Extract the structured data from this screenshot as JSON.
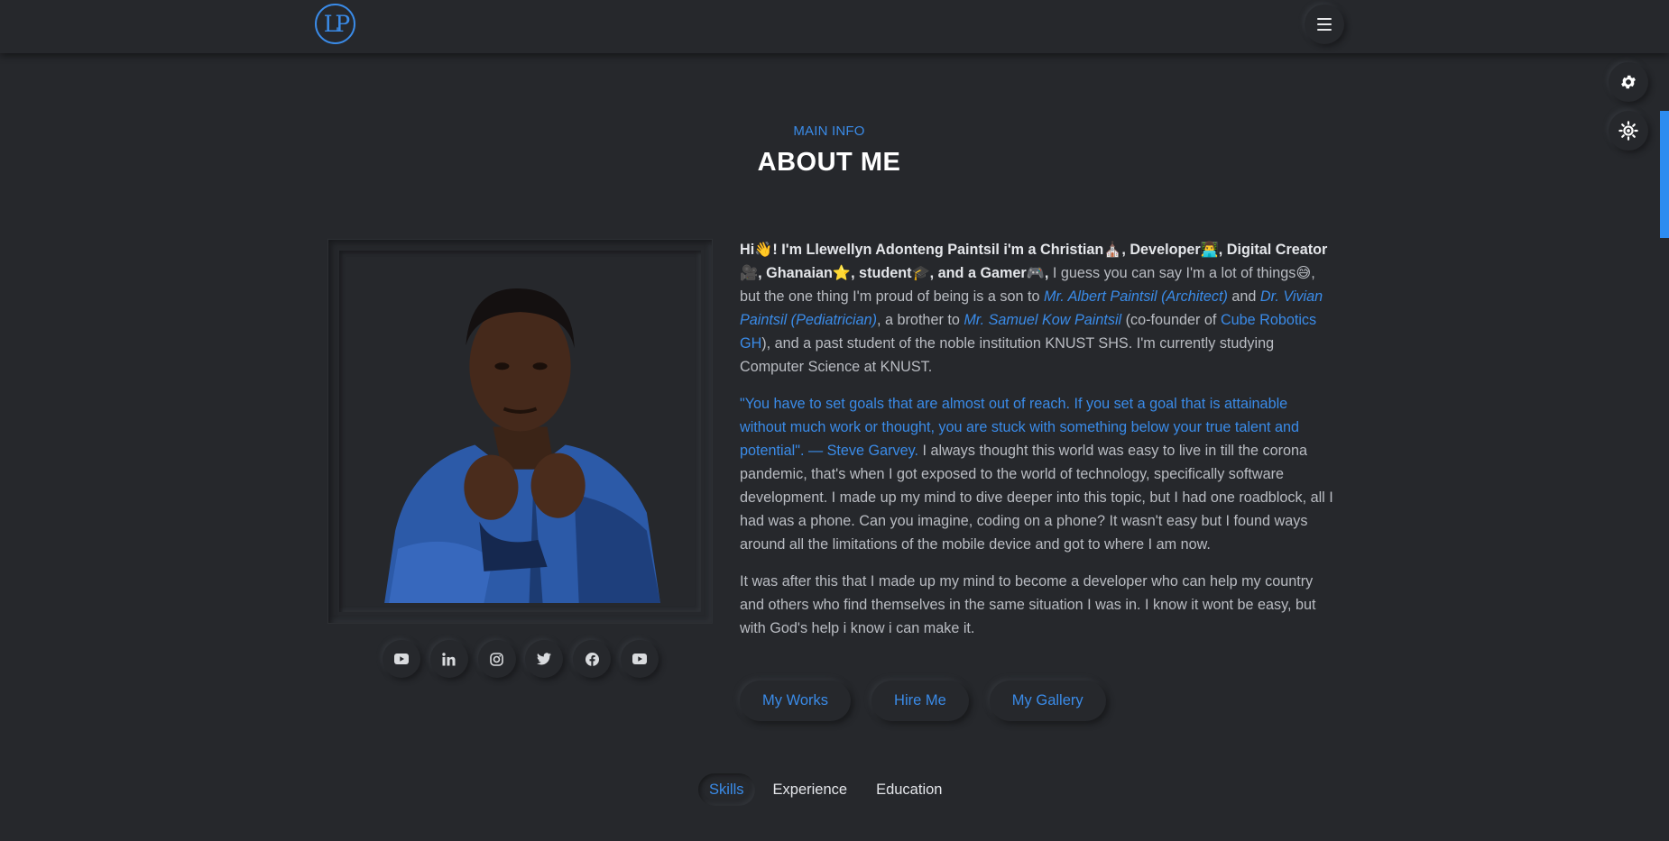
{
  "header": {
    "logo_text": "LP",
    "menu_icon": "hamburger-icon"
  },
  "side_buttons": [
    {
      "icon": "gear-icon"
    },
    {
      "icon": "sun-icon"
    }
  ],
  "section": {
    "eyebrow": "MAIN INFO",
    "title": "ABOUT ME"
  },
  "photo": {
    "alt": "Llewellyn Adonteng Paintsil"
  },
  "socials": [
    {
      "icon": "youtube-icon"
    },
    {
      "icon": "linkedin-icon"
    },
    {
      "icon": "instagram-icon"
    },
    {
      "icon": "twitter-icon"
    },
    {
      "icon": "facebook-icon"
    },
    {
      "icon": "youtube-icon"
    }
  ],
  "bio": {
    "p1": {
      "intro": "Hi👋! I'm Llewellyn Adonteng Paintsil i'm a Christian⛪, Developer👨‍💻, Digital Creator 🎥, Ghanaian⭐, student🎓, and a Gamer🎮,",
      "t1": " I guess you can say I'm a lot of things😅, but the one thing I'm proud of being is a son to ",
      "father": "Mr. Albert Paintsil (Architect)",
      "t2": " and ",
      "mother": "Dr. Vivian Paintsil (Pediatrician)",
      "t3": ", a brother to ",
      "brother": "Mr. Samuel Kow Paintsil",
      "t4": " (co-founder of ",
      "company": "Cube Robotics GH",
      "t5": "), and a past student of the noble institution KNUST SHS. I'm currently studying Computer Science at KNUST."
    },
    "p2": {
      "quote": "\"You have to set goals that are almost out of reach. If you set a goal that is attainable without much work or thought, you are stuck with something below your true talent and potential\". — Steve Garvey.",
      "rest": " I always thought this world was easy to live in till the corona pandemic, that's when I got exposed to the world of technology, specifically software development. I made up my mind to dive deeper into this topic, but I had one roadblock, all I had was a phone. Can you imagine, coding on a phone? It wasn't easy but I found ways around all the limitations of the mobile device and got to where I am now."
    },
    "p3": "It was after this that I made up my mind to become a developer who can help my country and others who find themselves in the same situation I was in. I know it wont be easy, but with God's help i know i can make it."
  },
  "actions": [
    "My Works",
    "Hire Me",
    "My Gallery"
  ],
  "tabs": {
    "items": [
      "Skills",
      "Experience",
      "Education"
    ],
    "active": "Skills"
  },
  "colors": {
    "background": "#26282c",
    "accent": "#3a8be8",
    "text": "#b9bcc2",
    "heading": "#ffffff"
  }
}
